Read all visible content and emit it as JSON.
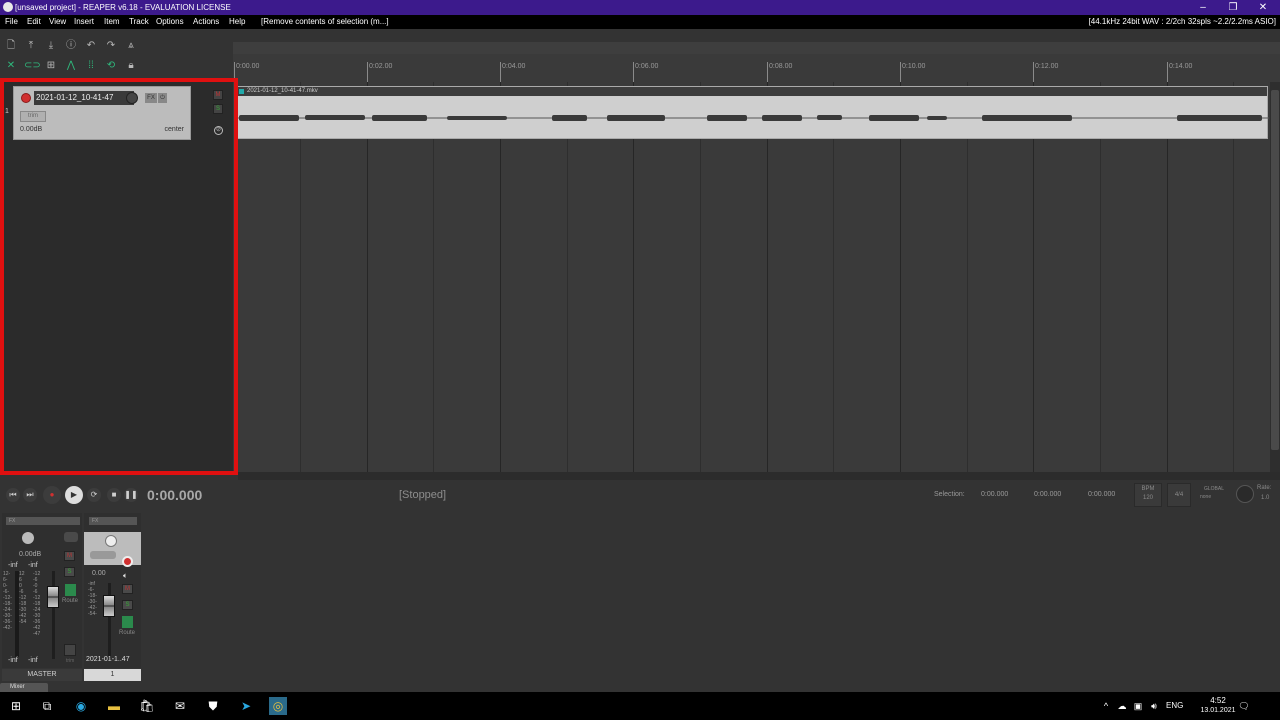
{
  "window": {
    "title": "[unsaved project] - REAPER v6.18 - EVALUATION LICENSE",
    "minimize": "–",
    "maximize": "❐",
    "close": "✕"
  },
  "menu": {
    "items": [
      "File",
      "Edit",
      "View",
      "Insert",
      "Item",
      "Track",
      "Options",
      "Actions",
      "Help"
    ],
    "status": "[Remove contents of selection (m...]",
    "audio_info": "[44.1kHz 24bit WAV : 2/2ch 32spls ~2.2/2.2ms ASIO]"
  },
  "ruler": {
    "labels": [
      "0:00.00",
      "0:02.00",
      "0:04.00",
      "0:06.00",
      "0:08.00",
      "0:10.00",
      "0:12.00",
      "0:14.00"
    ]
  },
  "track": {
    "number": "1",
    "name": "2021-01-12_10-41-47",
    "fx": "FX",
    "fx_power": "⏻",
    "trim": "trim",
    "volume": "0.00dB",
    "pan": "center",
    "mute": "M",
    "solo": "S",
    "phase": "⊘"
  },
  "item": {
    "label": "2021-01-12_10-41-47.mkv"
  },
  "transport": {
    "time": "0:00.000",
    "status": "[Stopped]",
    "selection_label": "Selection:",
    "sel_start": "0:00.000",
    "sel_end": "0:00.000",
    "sel_length": "0:00.000",
    "bpm_label": "BPM",
    "bpm": "120",
    "time_sig": "4/4",
    "global_label": "GLOBAL",
    "global_value": "none",
    "rate_label": "Rate:",
    "rate": "1.0"
  },
  "mixer": {
    "master": {
      "fx": "FX",
      "volume": "0.00dB",
      "peak_l": "-inf",
      "peak_r": "-inf",
      "bottom_l": "-inf",
      "bottom_r": "-inf",
      "route": "Route",
      "trim": "trim",
      "label": "MASTER",
      "mute": "M",
      "solo": "S"
    },
    "track": {
      "fx": "FX",
      "volume": "0.00",
      "peak": "-inf",
      "route": "Route",
      "name": "2021-01-1..47",
      "number": "1",
      "mute": "M",
      "solo": "S"
    },
    "tab": "Mixer",
    "scale_master_left": "12-\n6-\n0-\n-6-\n-12-\n-18-\n-24-\n-30-\n-36-\n-42-",
    "scale_master_mid": "12\n6\n0\n-6\n-12\n-18\n-30\n-42\n-54",
    "scale_master_right": "-12\n-6\n-0\n-6\n-12\n-18\n-24\n-30\n-36\n-42\n-47",
    "scale_track": "-inf\n-6-\n-18-\n-30-\n-42-\n-54-"
  },
  "taskbar": {
    "lang": "ENG",
    "time": "4:52",
    "date": "13.01.2021"
  },
  "colors": {
    "titlebar": "#3c1a8c",
    "highlight": "#e01010",
    "record": "#d03030",
    "item_body": "#cfcfcf"
  }
}
